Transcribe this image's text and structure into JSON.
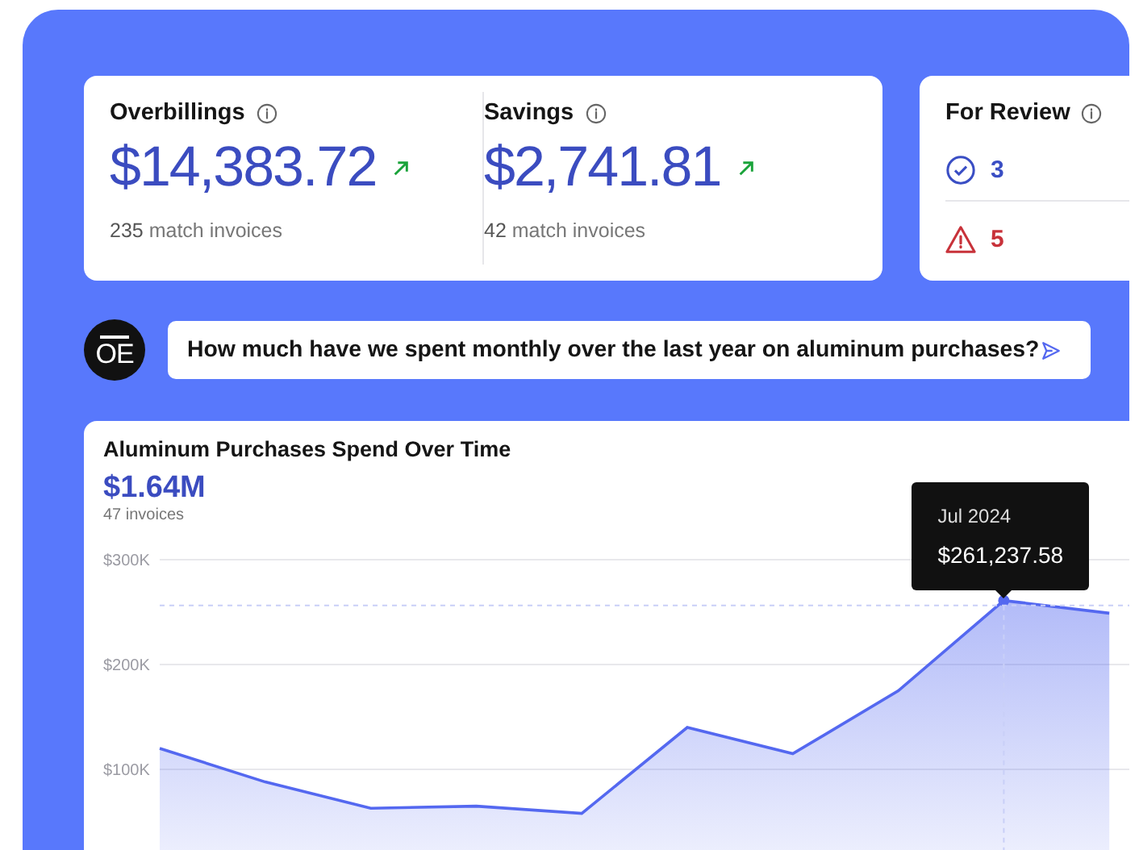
{
  "stats": [
    {
      "label": "Overbillings",
      "value": "$14,383.72",
      "trending_up": true,
      "note_count": "235",
      "note_text": "match invoices"
    },
    {
      "label": "Savings",
      "value": "$2,741.81",
      "trending_up": true,
      "note_count": "42",
      "note_text": "match invoices"
    }
  ],
  "review": {
    "title": "For Review",
    "items": [
      {
        "kind": "ok",
        "count": "3"
      },
      {
        "kind": "warning",
        "count": "5"
      }
    ]
  },
  "assistant": {
    "logo": "OE",
    "question": "How much have we spent monthly over the last year on aluminum purchases?"
  },
  "chart_card": {
    "title": "Aluminum Purchases Spend Over Time",
    "total": "$1.64M",
    "invoices": "47 invoices",
    "tooltip": {
      "label": "Jul 2024",
      "value": "$261,237.58"
    },
    "chart_data": {
      "type": "area",
      "categories": [
        null,
        null,
        null,
        null,
        null,
        null,
        null,
        null,
        null,
        null
      ],
      "ylim": [
        0,
        300000
      ],
      "yticks": [
        {
          "value": 100000,
          "label": "$100K"
        },
        {
          "value": 200000,
          "label": "$200K"
        },
        {
          "value": 300000,
          "label": "$300K"
        }
      ],
      "series": [
        {
          "color": "#5468f0",
          "values": [
            120000,
            88000,
            63000,
            65000,
            58000,
            140000,
            115000,
            175000,
            261000,
            249000
          ]
        }
      ]
    }
  }
}
